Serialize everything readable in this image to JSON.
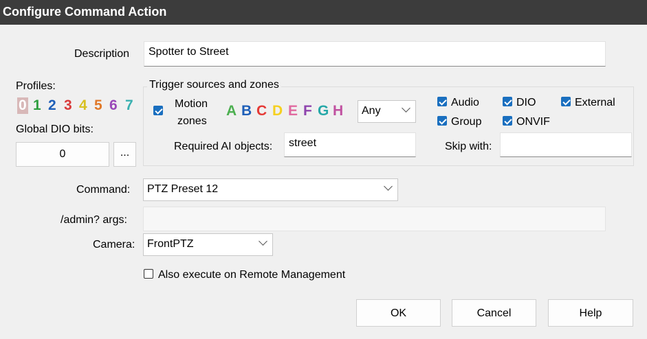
{
  "window": {
    "title": "Configure Command Action"
  },
  "description": {
    "label": "Description",
    "value": "Spotter to Street"
  },
  "profiles": {
    "label": "Profiles:",
    "items": [
      {
        "text": "0",
        "color": "#b08080"
      },
      {
        "text": "1",
        "color": "#2e9e3e"
      },
      {
        "text": "2",
        "color": "#1e5fb8"
      },
      {
        "text": "3",
        "color": "#d93a3a"
      },
      {
        "text": "4",
        "color": "#d8c020"
      },
      {
        "text": "5",
        "color": "#e07828"
      },
      {
        "text": "6",
        "color": "#9a48b8"
      },
      {
        "text": "7",
        "color": "#3ab0b0"
      }
    ]
  },
  "global_dio": {
    "label": "Global DIO bits:",
    "value": "0",
    "browse_label": "..."
  },
  "trigger": {
    "title": "Trigger sources and zones",
    "motion_zones": {
      "line1": "Motion",
      "line2": "zones",
      "checked": true
    },
    "zones": [
      {
        "text": "A",
        "color": "#4caf50"
      },
      {
        "text": "B",
        "color": "#1e5fb8"
      },
      {
        "text": "C",
        "color": "#e53935"
      },
      {
        "text": "D",
        "color": "#f5d020"
      },
      {
        "text": "E",
        "color": "#e06aa0"
      },
      {
        "text": "F",
        "color": "#8e44ad"
      },
      {
        "text": "G",
        "color": "#26a8a8"
      },
      {
        "text": "H",
        "color": "#c050a0"
      }
    ],
    "zone_mode": "Any",
    "sources": [
      {
        "label": "Audio",
        "checked": true
      },
      {
        "label": "DIO",
        "checked": true
      },
      {
        "label": "External",
        "checked": true
      },
      {
        "label": "Group",
        "checked": true
      },
      {
        "label": "ONVIF",
        "checked": true
      }
    ],
    "required_ai": {
      "label": "Required AI objects:",
      "value": "street"
    },
    "skip_with": {
      "label": "Skip with:",
      "value": ""
    }
  },
  "command": {
    "label": "Command:",
    "value": "PTZ Preset 12"
  },
  "admin_args": {
    "label": "/admin? args:",
    "value": ""
  },
  "camera": {
    "label": "Camera:",
    "value": "FrontPTZ"
  },
  "remote": {
    "label": "Also execute on Remote Management",
    "checked": false
  },
  "buttons": {
    "ok": "OK",
    "cancel": "Cancel",
    "help": "Help"
  }
}
